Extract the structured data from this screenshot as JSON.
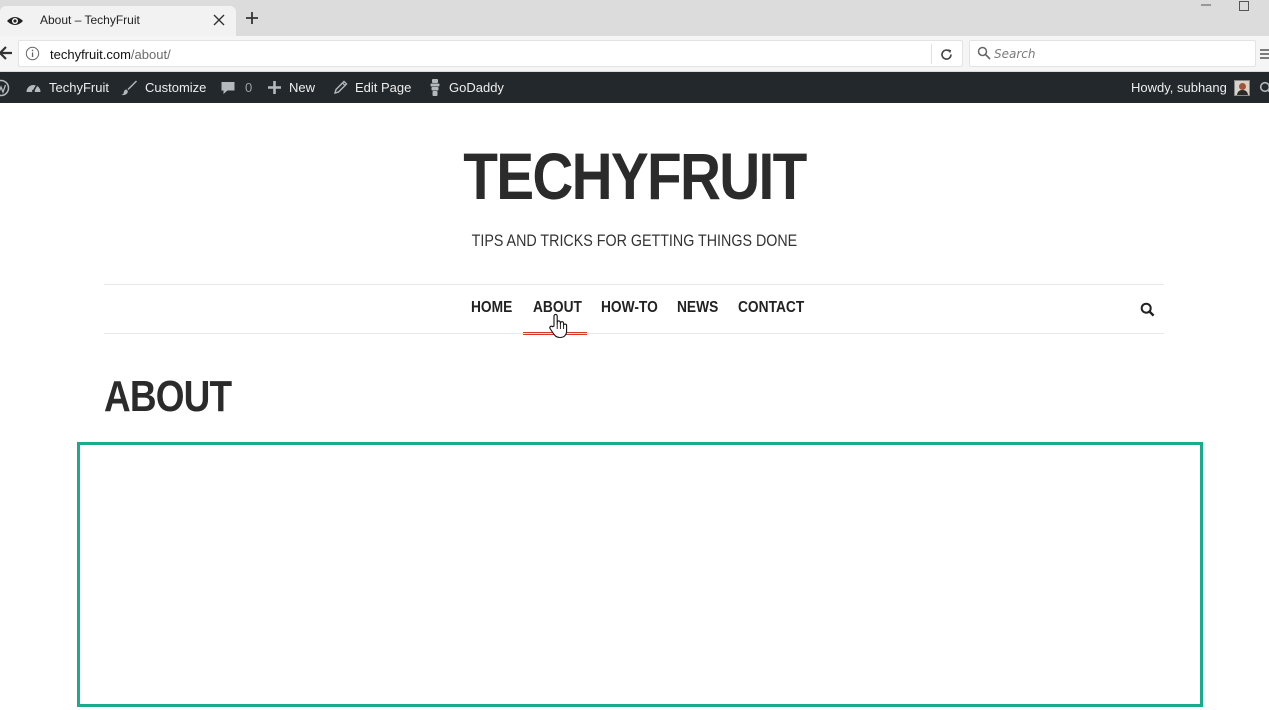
{
  "browser": {
    "tab_title": "About – TechyFruit",
    "url_domain": "techyfruit.com",
    "url_path": "/about/",
    "search_placeholder": "Search"
  },
  "admin_bar": {
    "site_name": "TechyFruit",
    "customize": "Customize",
    "comments_count": "0",
    "new": "New",
    "edit_page": "Edit Page",
    "godaddy": "GoDaddy",
    "howdy": "Howdy, subhang",
    "background_color": "#23282d"
  },
  "site": {
    "title": "TECHYFRUIT",
    "tagline": "TIPS AND TRICKS FOR GETTING THINGS DONE"
  },
  "menu": {
    "items": [
      {
        "label": "HOME"
      },
      {
        "label": "ABOUT",
        "active": true
      },
      {
        "label": "HOW-TO"
      },
      {
        "label": "NEWS"
      },
      {
        "label": "CONTACT"
      }
    ],
    "active_color": "#d33a2c"
  },
  "page": {
    "title": "ABOUT",
    "highlight_color": "#1aaa8c"
  },
  "icons": {
    "tab_favicon": "eye-icon",
    "back": "back-arrow-icon",
    "info": "info-icon",
    "reload": "reload-icon",
    "search": "search-icon",
    "wordpress": "wordpress-logo-icon",
    "dashboard": "dashboard-icon",
    "brush": "brush-icon",
    "comment": "comment-icon",
    "plus": "plus-icon",
    "pencil": "pencil-icon",
    "godaddy": "godaddy-icon"
  }
}
